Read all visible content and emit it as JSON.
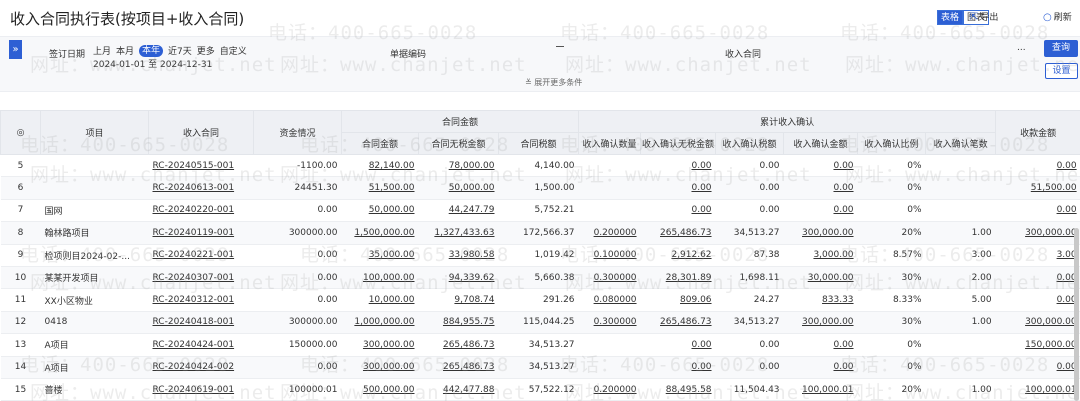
{
  "header": {
    "title": "收入合同执行表(按项目+收入合同)",
    "view_table": "表格",
    "view_chart": "图表",
    "export_label": "导出",
    "refresh_label": "刷新"
  },
  "filters": {
    "sign_date_label": "签订日期",
    "quick_options": [
      "上月",
      "本月",
      "本年",
      "近7天",
      "更多",
      "自定义"
    ],
    "active_option": "本年",
    "date_range": "2024-01-01 至 2024-12-31",
    "doc_code_label": "单据编码",
    "contract_label": "收入合同",
    "more_conditions": "展开更多条件",
    "ellipsis": "...",
    "query_button": "查询",
    "settings_button": "设置"
  },
  "watermarks": [
    "电话：400-665-0028",
    "网址：www.chanjet.net"
  ],
  "table": {
    "settings_icon": "gear-icon",
    "header_top": {
      "project": "项目",
      "contract": "收入合同",
      "funds": "资金情况",
      "group_amount": "合同金额",
      "group_income": "累计收入确认",
      "received": "收款金额"
    },
    "header_sub": [
      "合同金额",
      "合同无税金额",
      "合同税额",
      "收入确认数量",
      "收入确认无税金额",
      "收入确认税额",
      "收入确认金额",
      "收入确认比例",
      "收入确认笔数"
    ],
    "rows": [
      {
        "no": "5",
        "project": "",
        "contract": "RC-20240515-001",
        "funds": "-1100.00",
        "amt": "82,140.00",
        "notax": "78,000.00",
        "tax": "4,140.00",
        "qty": "",
        "inc_notax": "0.00",
        "inc_tax": "0.00",
        "inc_amt": "0.00",
        "ratio": "0%",
        "count": "",
        "received": "0.00"
      },
      {
        "no": "6",
        "project": "",
        "contract": "RC-20240613-001",
        "funds": "24451.30",
        "amt": "51,500.00",
        "notax": "50,000.00",
        "tax": "1,500.00",
        "qty": "",
        "inc_notax": "0.00",
        "inc_tax": "0.00",
        "inc_amt": "0.00",
        "ratio": "0%",
        "count": "",
        "received": "51,500.00"
      },
      {
        "no": "7",
        "project": "国网",
        "contract": "RC-20240220-001",
        "funds": "0.00",
        "amt": "50,000.00",
        "notax": "44,247.79",
        "tax": "5,752.21",
        "qty": "",
        "inc_notax": "0.00",
        "inc_tax": "0.00",
        "inc_amt": "0.00",
        "ratio": "0%",
        "count": "",
        "received": "0.00"
      },
      {
        "no": "8",
        "project": "翰林路项目",
        "contract": "RC-20240119-001",
        "funds": "300000.00",
        "amt": "1,500,000.00",
        "notax": "1,327,433.63",
        "tax": "172,566.37",
        "qty": "0.200000",
        "inc_notax": "265,486.73",
        "inc_tax": "34,513.27",
        "inc_amt": "300,000.00",
        "ratio": "20%",
        "count": "1.00",
        "received": "300,000.00"
      },
      {
        "no": "9",
        "project": "检项则目2024-02-...",
        "contract": "RC-20240221-001",
        "funds": "0.00",
        "amt": "35,000.00",
        "notax": "33,980.58",
        "tax": "1,019.42",
        "qty": "0.100000",
        "inc_notax": "2,912.62",
        "inc_tax": "87.38",
        "inc_amt": "3,000.00",
        "ratio": "8.57%",
        "count": "3.00",
        "received": "3.00"
      },
      {
        "no": "10",
        "project": "某某开发项目",
        "contract": "RC-20240307-001",
        "funds": "0.00",
        "amt": "100,000.00",
        "notax": "94,339.62",
        "tax": "5,660.38",
        "qty": "0.300000",
        "inc_notax": "28,301.89",
        "inc_tax": "1,698.11",
        "inc_amt": "30,000.00",
        "ratio": "30%",
        "count": "2.00",
        "received": "0.00"
      },
      {
        "no": "11",
        "project": "XX小区物业",
        "contract": "RC-20240312-001",
        "funds": "0.00",
        "amt": "10,000.00",
        "notax": "9,708.74",
        "tax": "291.26",
        "qty": "0.080000",
        "inc_notax": "809.06",
        "inc_tax": "24.27",
        "inc_amt": "833.33",
        "ratio": "8.33%",
        "count": "5.00",
        "received": "0.00"
      },
      {
        "no": "12",
        "project": "0418",
        "contract": "RC-20240418-001",
        "funds": "300000.00",
        "amt": "1,000,000.00",
        "notax": "884,955.75",
        "tax": "115,044.25",
        "qty": "0.300000",
        "inc_notax": "265,486.73",
        "inc_tax": "34,513.27",
        "inc_amt": "300,000.00",
        "ratio": "30%",
        "count": "1.00",
        "received": "300,000.00"
      },
      {
        "no": "13",
        "project": "A项目",
        "contract": "RC-20240424-001",
        "funds": "150000.00",
        "amt": "300,000.00",
        "notax": "265,486.73",
        "tax": "34,513.27",
        "qty": "",
        "inc_notax": "0.00",
        "inc_tax": "0.00",
        "inc_amt": "0.00",
        "ratio": "0%",
        "count": "",
        "received": "150,000.00"
      },
      {
        "no": "14",
        "project": "A项目",
        "contract": "RC-20240424-002",
        "funds": "0.00",
        "amt": "300,000.00",
        "notax": "265,486.73",
        "tax": "34,513.27",
        "qty": "",
        "inc_notax": "0.00",
        "inc_tax": "0.00",
        "inc_amt": "0.00",
        "ratio": "0%",
        "count": "",
        "received": "0.00"
      },
      {
        "no": "15",
        "project": "蔷楼",
        "contract": "RC-20240619-001",
        "funds": "100000.01",
        "amt": "500,000.00",
        "notax": "442,477.88",
        "tax": "57,522.12",
        "qty": "0.200000",
        "inc_notax": "88,495.58",
        "inc_tax": "11,504.43",
        "inc_amt": "100,000.01",
        "ratio": "20%",
        "count": "1.00",
        "received": "100,000.01"
      }
    ]
  }
}
